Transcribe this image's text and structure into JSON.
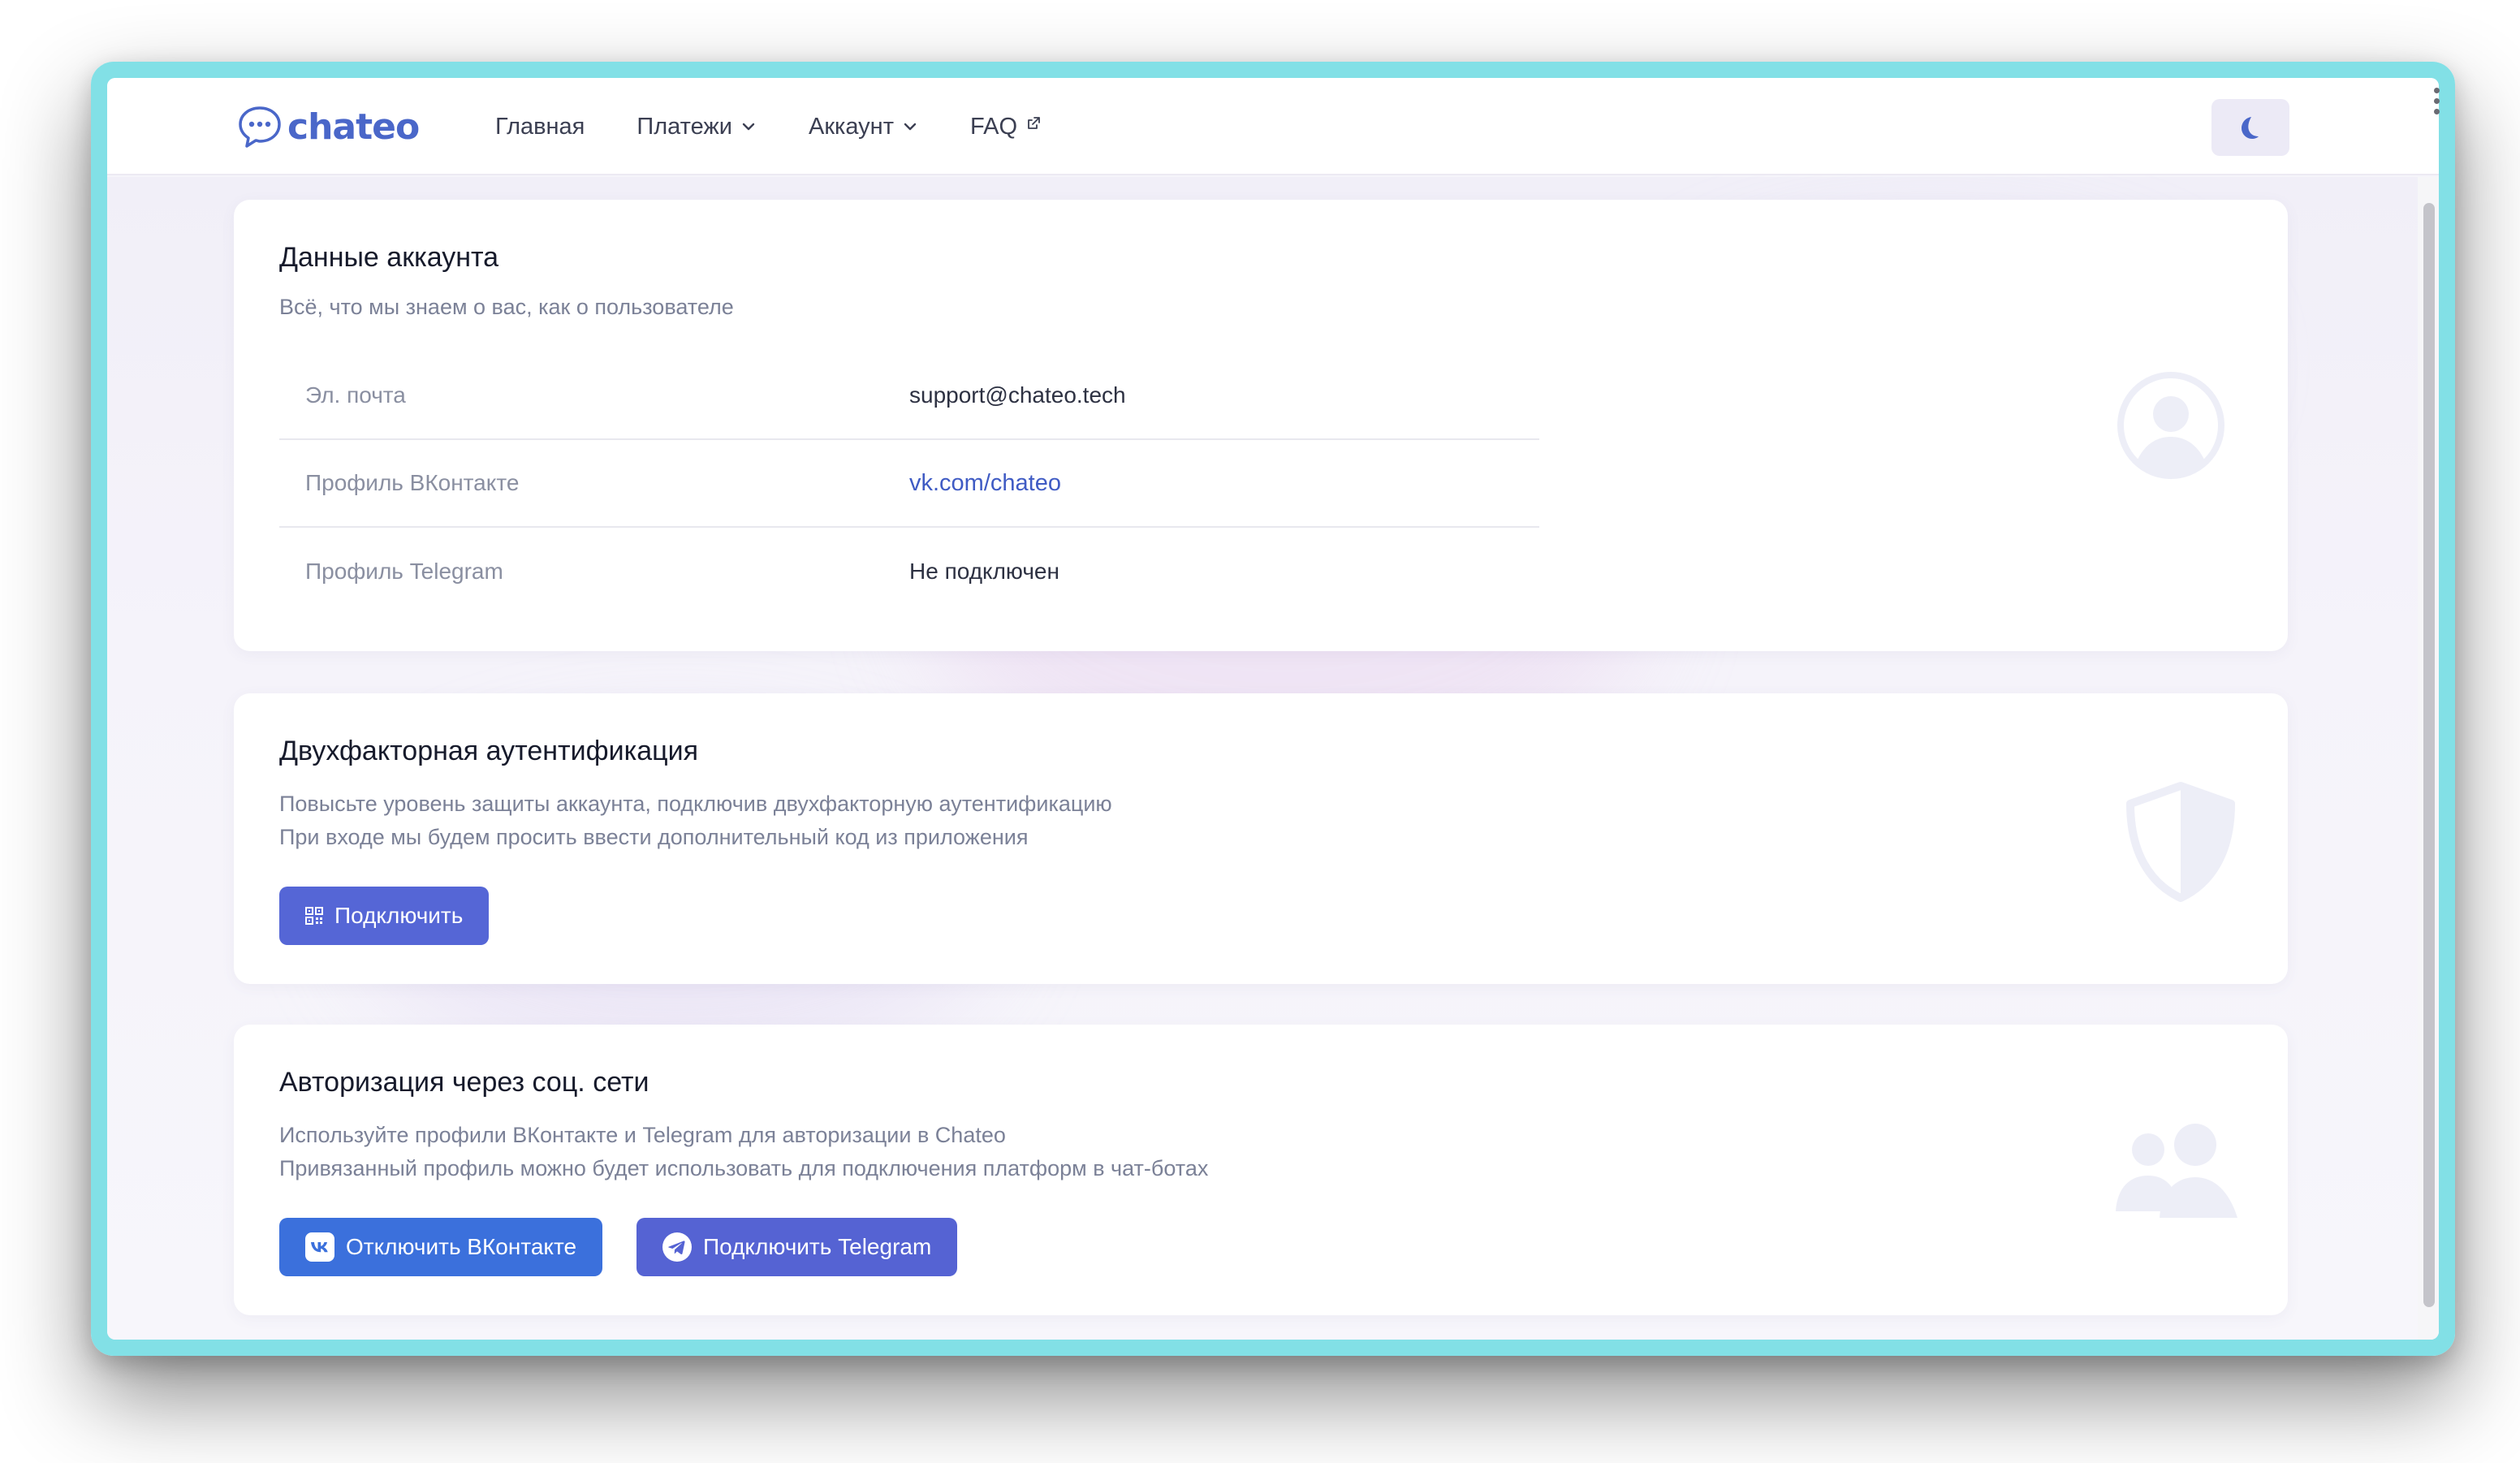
{
  "brand": {
    "name": "chateo"
  },
  "nav": {
    "items": [
      {
        "label": "Главная",
        "type": "link"
      },
      {
        "label": "Платежи",
        "type": "dropdown"
      },
      {
        "label": "Аккаунт",
        "type": "dropdown"
      },
      {
        "label": "FAQ",
        "type": "external"
      }
    ]
  },
  "account_card": {
    "title": "Данные аккаунта",
    "subtitle": "Всё, что мы знаем о вас, как о пользователе",
    "rows": [
      {
        "label": "Эл. почта",
        "value": "support@chateo.tech"
      },
      {
        "label": "Профиль ВКонтакте",
        "value": "vk.com/chateo"
      },
      {
        "label": "Профиль Telegram",
        "value": "Не подключен"
      }
    ],
    "illustration_icon": "user-circle-icon"
  },
  "twofa_card": {
    "title": "Двухфакторная аутентификация",
    "subtitle_lines": [
      "Повысьте уровень защиты аккаунта, подключив двухфакторную аутентификацию",
      "При входе мы будем просить ввести дополнительный код из приложения"
    ],
    "button_label": "Подключить",
    "illustration_icon": "shield-icon"
  },
  "social_card": {
    "title": "Авторизация через соц. сети",
    "subtitle_lines": [
      "Используйте профили ВКонтакте и Telegram для авторизации в Chateo",
      "Привязанный профиль можно будет использовать для подключения платформ в чат-ботах"
    ],
    "vk_button_label": "Отключить ВКонтакте",
    "tg_button_label": "Подключить Telegram",
    "illustration_icon": "users-icon"
  },
  "colors": {
    "window_frame": "#82e0e6",
    "brand": "#4a67c9",
    "primary_button": "#5566d6",
    "vk_button": "#3b70dc",
    "link": "#3f5bc4"
  }
}
